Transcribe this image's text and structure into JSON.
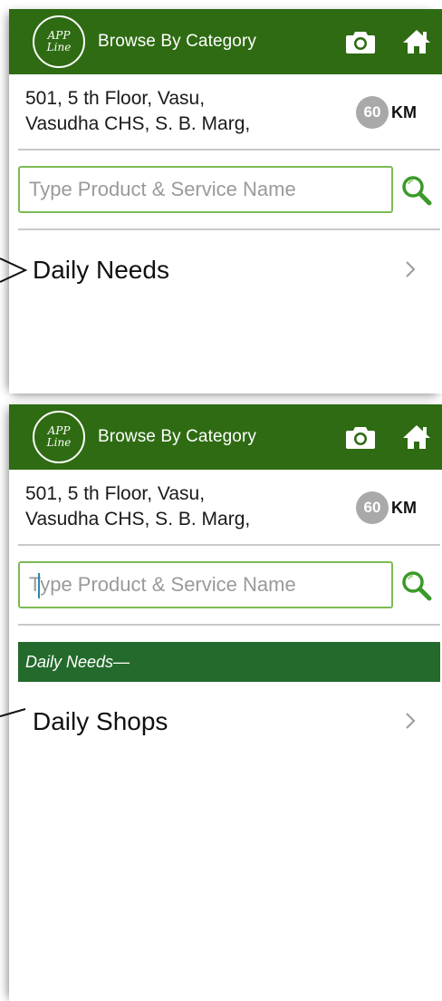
{
  "screens": [
    {
      "header": {
        "title": "Browse By Category",
        "logo_top": "APP",
        "logo_bottom": "Line"
      },
      "address": {
        "line1": "501, 5 th Floor, Vasu,",
        "line2": "Vasudha CHS, S. B. Marg,"
      },
      "distance": {
        "value": "60",
        "unit": "KM"
      },
      "search": {
        "placeholder": "Type Product & Service Name"
      },
      "items": [
        {
          "label": "Daily Needs"
        }
      ]
    },
    {
      "header": {
        "title": "Browse By Category",
        "logo_top": "APP",
        "logo_bottom": "Line"
      },
      "address": {
        "line1": "501, 5 th Floor, Vasu,",
        "line2": "Vasudha CHS, S. B. Marg,"
      },
      "distance": {
        "value": "60",
        "unit": "KM"
      },
      "search": {
        "placeholder": "Type Product & Service Name"
      },
      "breadcrumb": "Daily Needs—",
      "items": [
        {
          "label": "Daily Shops"
        }
      ]
    }
  ],
  "icons": {
    "camera": "camera-icon",
    "home": "home-icon",
    "search": "search-icon",
    "chevron": "chevron-right-icon",
    "pointer": "pointer-arrow-icon"
  },
  "colors": {
    "appbar": "#2e6b12",
    "section_header": "#236a2c",
    "search_border": "#7cbb56",
    "search_icon": "#3a9a2a",
    "km_badge": "#a9a9a9"
  }
}
